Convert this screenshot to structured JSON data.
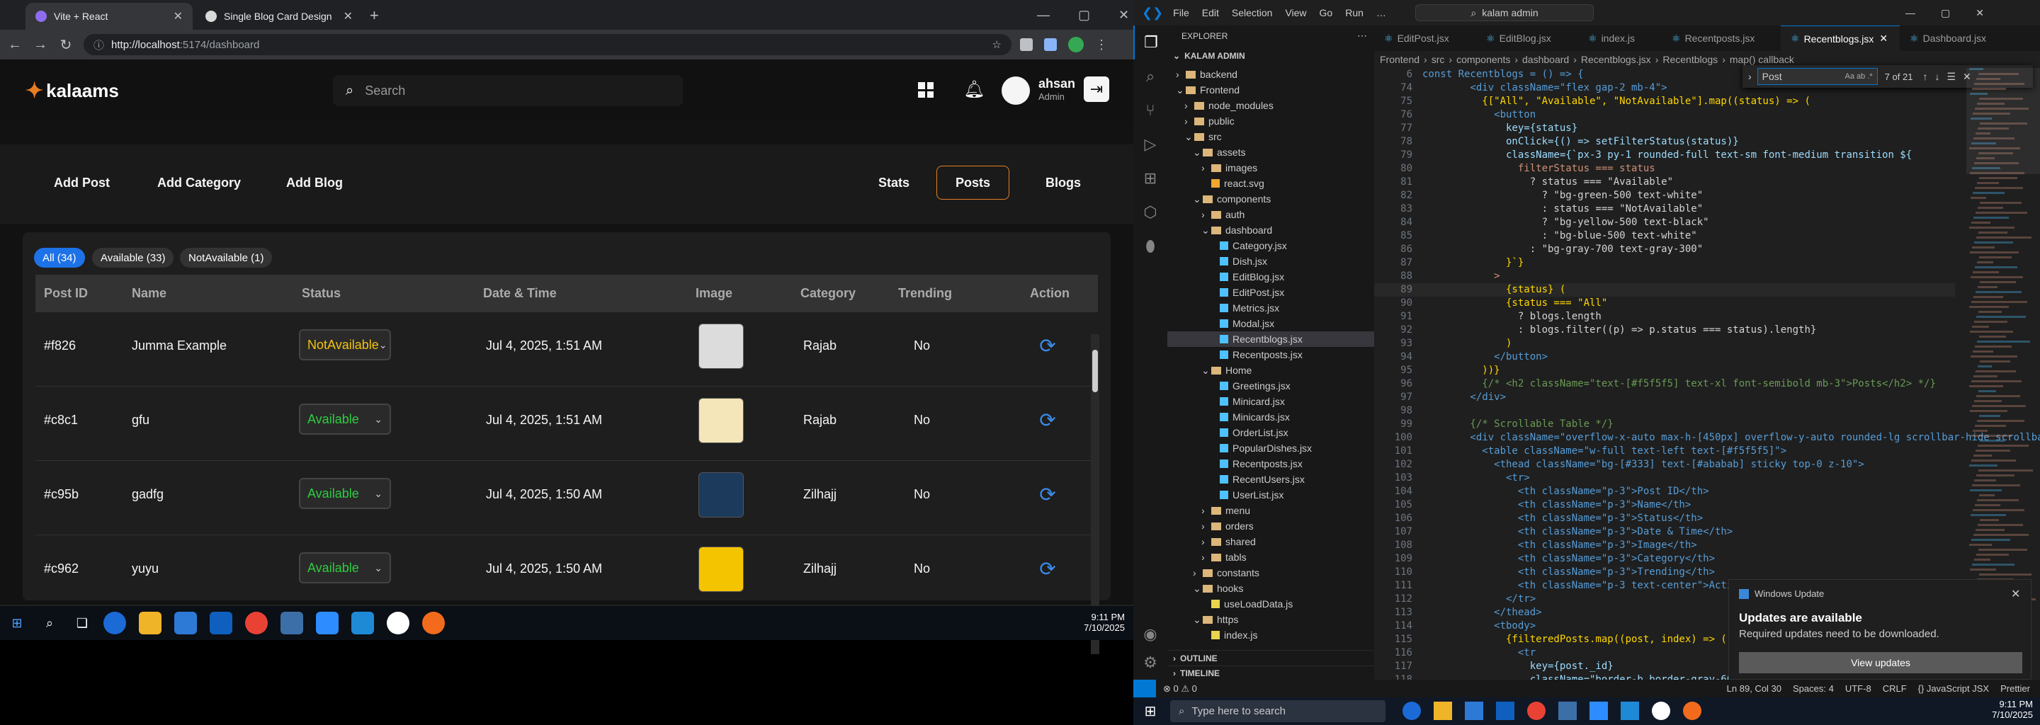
{
  "browser": {
    "tabs": [
      {
        "label": "Vite + React",
        "active": true,
        "color": "#8e6cf0"
      },
      {
        "label": "Single Blog Card Design",
        "active": false,
        "color": "#d9d9d9"
      }
    ],
    "url_host": "http://localhost",
    "url_path": ":5174/dashboard",
    "new_tab": "+"
  },
  "app": {
    "logo": "kalaams",
    "search_placeholder": "Search",
    "user_name": "ahsan",
    "user_role": "Admin",
    "actions_left": [
      "Add Post",
      "Add Category",
      "Add Blog"
    ],
    "actions_right": [
      "Stats",
      "Posts",
      "Blogs"
    ],
    "active_action": "Posts",
    "filters": [
      "All (34)",
      "Available (33)",
      "NotAvailable (1)"
    ],
    "columns": [
      "Post ID",
      "Name",
      "Status",
      "Date & Time",
      "Image",
      "Category",
      "Trending",
      "Action"
    ],
    "rows": [
      {
        "id": "#f826",
        "name": "Jumma Example",
        "status": "NotAvailable",
        "status_color": "#f1c40f",
        "date": "Jul 4, 2025, 1:51 AM",
        "thumb": "#dcdcdc",
        "category": "Rajab",
        "trending": "No"
      },
      {
        "id": "#c8c1",
        "name": "gfu",
        "status": "Available",
        "status_color": "#2ecc40",
        "date": "Jul 4, 2025, 1:51 AM",
        "thumb": "#f4e6b8",
        "category": "Rajab",
        "trending": "No"
      },
      {
        "id": "#c95b",
        "name": "gadfg",
        "status": "Available",
        "status_color": "#2ecc40",
        "date": "Jul 4, 2025, 1:50 AM",
        "thumb": "#1b3a5c",
        "category": "Zilhajj",
        "trending": "No"
      },
      {
        "id": "#c962",
        "name": "yuyu",
        "status": "Available",
        "status_color": "#2ecc40",
        "date": "Jul 4, 2025, 1:50 AM",
        "thumb": "#f5c400",
        "category": "Zilhajj",
        "trending": "No"
      }
    ],
    "brand_color": "#e67e22",
    "accent_blue": "#1d72e8"
  },
  "left_taskbar": {
    "time": "9:11 PM",
    "date": "7/10/2025"
  },
  "vscode": {
    "menu": [
      "File",
      "Edit",
      "Selection",
      "View",
      "Go",
      "Run",
      "…"
    ],
    "command_center": "kalam admin",
    "explorer_title": "EXPLORER",
    "workspace": "KALAM ADMIN",
    "tree": [
      {
        "label": "backend",
        "depth": 1,
        "type": "folder",
        "open": false
      },
      {
        "label": "Frontend",
        "depth": 1,
        "type": "folder",
        "open": true
      },
      {
        "label": "node_modules",
        "depth": 2,
        "type": "folder",
        "open": false
      },
      {
        "label": "public",
        "depth": 2,
        "type": "folder",
        "open": false
      },
      {
        "label": "src",
        "depth": 2,
        "type": "folder",
        "open": true
      },
      {
        "label": "assets",
        "depth": 3,
        "type": "folder",
        "open": true
      },
      {
        "label": "images",
        "depth": 4,
        "type": "folder",
        "open": false
      },
      {
        "label": "react.svg",
        "depth": 4,
        "type": "file"
      },
      {
        "label": "components",
        "depth": 3,
        "type": "folder",
        "open": true
      },
      {
        "label": "auth",
        "depth": 4,
        "type": "folder",
        "open": false
      },
      {
        "label": "dashboard",
        "depth": 4,
        "type": "folder",
        "open": true
      },
      {
        "label": "Category.jsx",
        "depth": 5,
        "type": "file"
      },
      {
        "label": "Dish.jsx",
        "depth": 5,
        "type": "file"
      },
      {
        "label": "EditBlog.jsx",
        "depth": 5,
        "type": "file"
      },
      {
        "label": "EditPost.jsx",
        "depth": 5,
        "type": "file"
      },
      {
        "label": "Metrics.jsx",
        "depth": 5,
        "type": "file"
      },
      {
        "label": "Modal.jsx",
        "depth": 5,
        "type": "file"
      },
      {
        "label": "Recentblogs.jsx",
        "depth": 5,
        "type": "file",
        "selected": true
      },
      {
        "label": "Recentposts.jsx",
        "depth": 5,
        "type": "file"
      },
      {
        "label": "Home",
        "depth": 4,
        "type": "folder",
        "open": true
      },
      {
        "label": "Greetings.jsx",
        "depth": 5,
        "type": "file"
      },
      {
        "label": "Minicard.jsx",
        "depth": 5,
        "type": "file"
      },
      {
        "label": "Minicards.jsx",
        "depth": 5,
        "type": "file"
      },
      {
        "label": "OrderList.jsx",
        "depth": 5,
        "type": "file"
      },
      {
        "label": "PopularDishes.jsx",
        "depth": 5,
        "type": "file"
      },
      {
        "label": "Recentposts.jsx",
        "depth": 5,
        "type": "file"
      },
      {
        "label": "RecentUsers.jsx",
        "depth": 5,
        "type": "file"
      },
      {
        "label": "UserList.jsx",
        "depth": 5,
        "type": "file"
      },
      {
        "label": "menu",
        "depth": 4,
        "type": "folder",
        "open": false
      },
      {
        "label": "orders",
        "depth": 4,
        "type": "folder",
        "open": false
      },
      {
        "label": "shared",
        "depth": 4,
        "type": "folder",
        "open": false
      },
      {
        "label": "tabls",
        "depth": 4,
        "type": "folder",
        "open": false
      },
      {
        "label": "constants",
        "depth": 3,
        "type": "folder",
        "open": false
      },
      {
        "label": "hooks",
        "depth": 3,
        "type": "folder",
        "open": true
      },
      {
        "label": "useLoadData.js",
        "depth": 4,
        "type": "file"
      },
      {
        "label": "https",
        "depth": 3,
        "type": "folder",
        "open": true
      },
      {
        "label": "index.js",
        "depth": 4,
        "type": "file"
      }
    ],
    "outline": "OUTLINE",
    "timeline": "TIMELINE",
    "editor_tabs": [
      "EditPost.jsx",
      "EditBlog.jsx",
      "index.js",
      "Recentposts.jsx",
      "Recentblogs.jsx",
      "Dashboard.jsx"
    ],
    "active_tab": "Recentblogs.jsx",
    "breadcrumb": [
      "Frontend",
      "src",
      "components",
      "dashboard",
      "Recentblogs.jsx",
      "Recentblogs",
      "map() callback"
    ],
    "find_query": "Post",
    "find_count": "7 of 21",
    "code_header": "const Recentblogs = () => {",
    "code": [
      {
        "n": 74,
        "t": "        <div className=\"flex gap-2 mb-4\">"
      },
      {
        "n": 75,
        "t": "          {[\"All\", \"Available\", \"NotAvailable\"].map((status) => ("
      },
      {
        "n": 76,
        "t": "            <button"
      },
      {
        "n": 77,
        "t": "              key={status}"
      },
      {
        "n": 78,
        "t": "              onClick={() => setFilterStatus(status)}"
      },
      {
        "n": 79,
        "t": "              className={`px-3 py-1 rounded-full text-sm font-medium transition ${"
      },
      {
        "n": 80,
        "t": "                filterStatus === status"
      },
      {
        "n": 81,
        "t": "                  ? status === \"Available\""
      },
      {
        "n": 82,
        "t": "                    ? \"bg-green-500 text-white\""
      },
      {
        "n": 83,
        "t": "                    : status === \"NotAvailable\""
      },
      {
        "n": 84,
        "t": "                    ? \"bg-yellow-500 text-black\""
      },
      {
        "n": 85,
        "t": "                    : \"bg-blue-500 text-white\""
      },
      {
        "n": 86,
        "t": "                  : \"bg-gray-700 text-gray-300\""
      },
      {
        "n": 87,
        "t": "              }`}"
      },
      {
        "n": 88,
        "t": "            >"
      },
      {
        "n": 89,
        "t": "              {status} ("
      },
      {
        "n": 90,
        "t": "              {status === \"All\""
      },
      {
        "n": 91,
        "t": "                ? blogs.length"
      },
      {
        "n": 92,
        "t": "                : blogs.filter((p) => p.status === status).length}"
      },
      {
        "n": 93,
        "t": "              )"
      },
      {
        "n": 94,
        "t": "            </button>"
      },
      {
        "n": 95,
        "t": "          ))}"
      },
      {
        "n": 96,
        "t": "          {/* <h2 className=\"text-[#f5f5f5] text-xl font-semibold mb-3\">Posts</h2> */}"
      },
      {
        "n": 97,
        "t": "        </div>"
      },
      {
        "n": 98,
        "t": ""
      },
      {
        "n": 99,
        "t": "        {/* Scrollable Table */}"
      },
      {
        "n": 100,
        "t": "        <div className=\"overflow-x-auto max-h-[450px] overflow-y-auto rounded-lg scrollbar-hide scrollba"
      },
      {
        "n": 101,
        "t": "          <table className=\"w-full text-left text-[#f5f5f5]\">"
      },
      {
        "n": 102,
        "t": "            <thead className=\"bg-[#333] text-[#ababab] sticky top-0 z-10\">"
      },
      {
        "n": 103,
        "t": "              <tr>"
      },
      {
        "n": 104,
        "t": "                <th className=\"p-3\">Post ID</th>"
      },
      {
        "n": 105,
        "t": "                <th className=\"p-3\">Name</th>"
      },
      {
        "n": 106,
        "t": "                <th className=\"p-3\">Status</th>"
      },
      {
        "n": 107,
        "t": "                <th className=\"p-3\">Date & Time</th>"
      },
      {
        "n": 108,
        "t": "                <th className=\"p-3\">Image</th>"
      },
      {
        "n": 109,
        "t": "                <th className=\"p-3\">Category</th>"
      },
      {
        "n": 110,
        "t": "                <th className=\"p-3\">Trending</th>"
      },
      {
        "n": 111,
        "t": "                <th className=\"p-3 text-center\">Action</th>"
      },
      {
        "n": 112,
        "t": "              </tr>"
      },
      {
        "n": 113,
        "t": "            </thead>"
      },
      {
        "n": 114,
        "t": "            <tbody>"
      },
      {
        "n": 115,
        "t": "              {filteredPosts.map((post, index) => ("
      },
      {
        "n": 116,
        "t": "                <tr"
      },
      {
        "n": 117,
        "t": "                  key={post._id}"
      },
      {
        "n": 118,
        "t": "                  className=\"border-b border-gray-600 hover:bg-[#3"
      }
    ],
    "toast": {
      "app": "Windows Update",
      "title": "Updates are available",
      "body": "Required updates need to be downloaded.",
      "button": "View updates"
    },
    "status_items": [
      "Ln 89, Col 30",
      "Spaces: 4",
      "UTF-8",
      "CRLF",
      "{} JavaScript JSX",
      "Prettier"
    ],
    "status_left": "⊗ 0 ⚠ 0"
  },
  "right_taskbar": {
    "search_placeholder": "Type here to search",
    "time": "9:11 PM",
    "date": "7/10/2025"
  }
}
